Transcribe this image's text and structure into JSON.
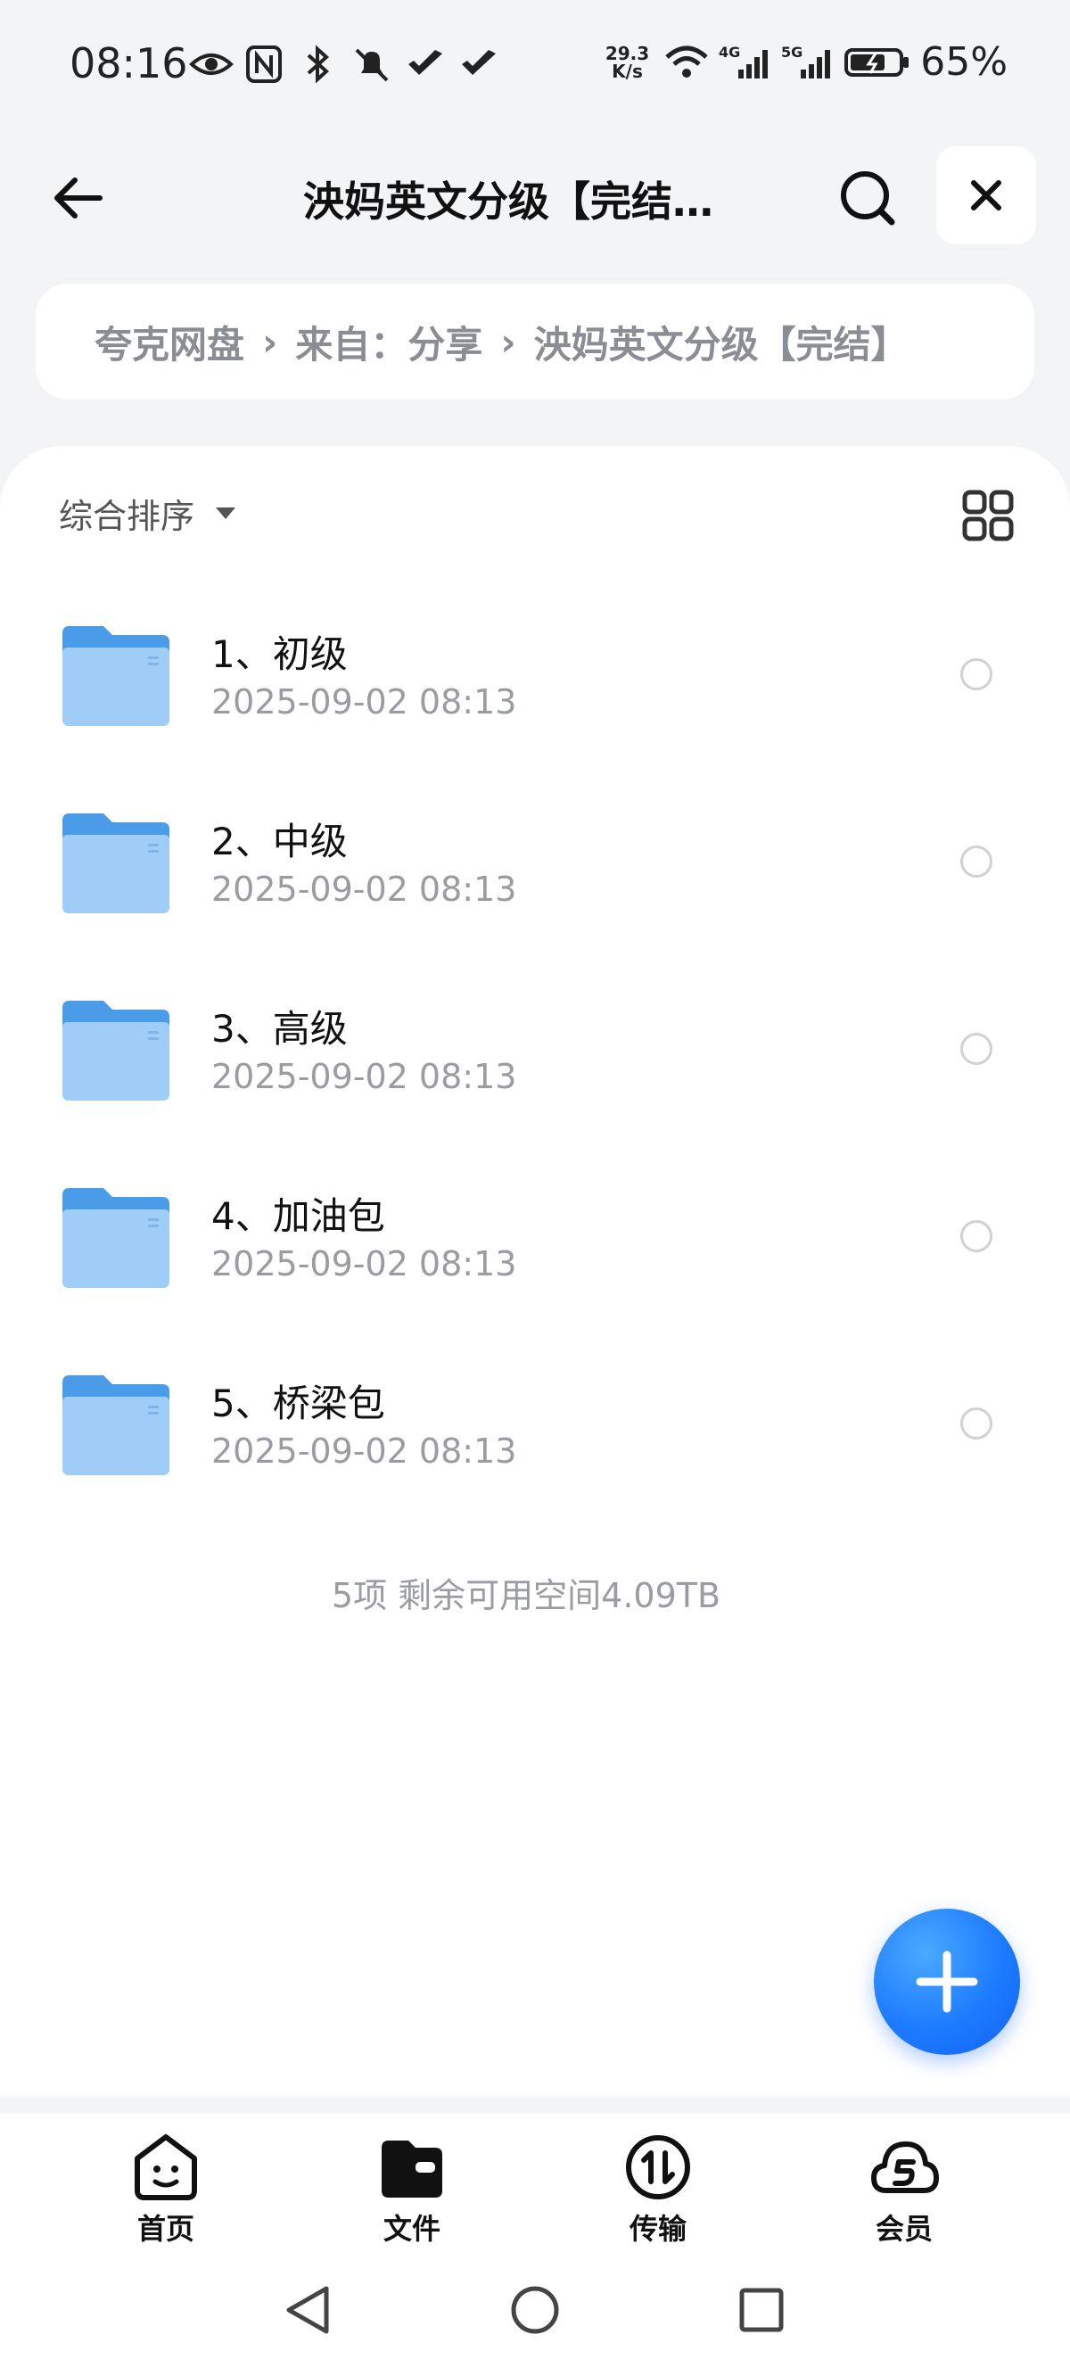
{
  "status_bar": {
    "time": "08:16",
    "net_speed_value": "29.3",
    "net_speed_unit": "K/s",
    "network_4g": "4G",
    "network_5g": "5G",
    "battery": "65%"
  },
  "header": {
    "title": "泱妈英文分级【完结…"
  },
  "breadcrumb": {
    "items": [
      "夸克网盘",
      "来自：分享",
      "泱妈英文分级【完结】"
    ]
  },
  "toolbar": {
    "sort_label": "综合排序"
  },
  "files": [
    {
      "name": "1、初级",
      "date": "2025-09-02 08:13"
    },
    {
      "name": "2、中级",
      "date": "2025-09-02 08:13"
    },
    {
      "name": "3、高级",
      "date": "2025-09-02 08:13"
    },
    {
      "name": "4、加油包",
      "date": "2025-09-02 08:13"
    },
    {
      "name": "5、桥梁包",
      "date": "2025-09-02 08:13"
    }
  ],
  "storage_info": "5项 剩余可用空间4.09TB",
  "bottom_nav": {
    "items": [
      {
        "label": "首页",
        "icon": "home-face-icon"
      },
      {
        "label": "文件",
        "icon": "folder-wallet-icon"
      },
      {
        "label": "传输",
        "icon": "transfer-icon"
      },
      {
        "label": "会员",
        "icon": "cloud-s-icon"
      }
    ]
  },
  "colors": {
    "accent": "#1d7bff",
    "folder": "#5aa8f0",
    "background": "#f3f4f6"
  }
}
